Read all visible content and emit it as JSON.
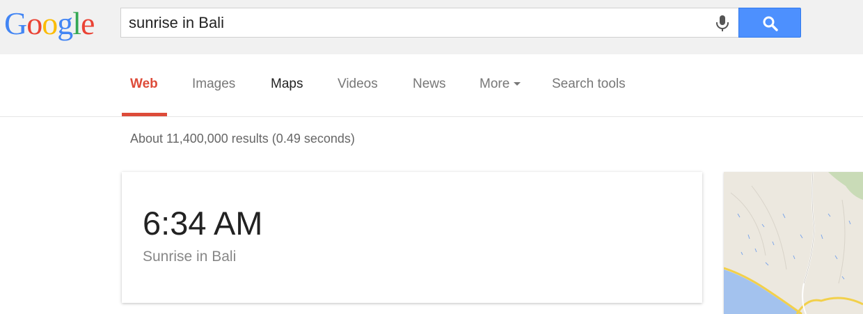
{
  "header": {
    "logo": {
      "letters": [
        "G",
        "o",
        "o",
        "g",
        "l",
        "e"
      ],
      "colors": [
        "#4285f4",
        "#ea4335",
        "#fbbc05",
        "#4285f4",
        "#34a853",
        "#ea4335"
      ]
    },
    "search": {
      "query": "sunrise in Bali"
    },
    "icons": {
      "mic": "microphone-icon",
      "search": "magnifier-icon"
    },
    "accent": "#4d90fe"
  },
  "nav": {
    "items": [
      {
        "label": "Web",
        "state": "active"
      },
      {
        "label": "Images"
      },
      {
        "label": "Maps"
      },
      {
        "label": "Videos"
      },
      {
        "label": "News"
      },
      {
        "label": "More"
      },
      {
        "label": "Search tools"
      }
    ],
    "active_color": "#dd4b39"
  },
  "results": {
    "stats": "About 11,400,000 results (0.49 seconds)"
  },
  "answer": {
    "time": "6:34 AM",
    "subtitle": "Sunrise in Bali"
  }
}
